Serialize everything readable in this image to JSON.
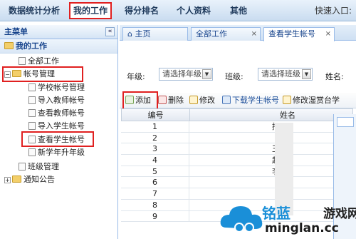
{
  "topnav": {
    "items": [
      "数据统计分析",
      "我的工作",
      "得分排名",
      "个人资料",
      "其他"
    ],
    "quick_entry": "快速入口:"
  },
  "sidebar": {
    "title": "主菜单",
    "collapse_glyph": "«",
    "section": "我的工作",
    "tree": {
      "all_work": "全部工作",
      "account_mgmt": "帐号管理",
      "children": [
        "学校帐号管理",
        "导入教师帐号",
        "查看教师帐号",
        "导入学生帐号",
        "查看学生帐号",
        "新学年升年级"
      ],
      "class_mgmt": "班级管理",
      "notice": "通知公告"
    }
  },
  "tabs": [
    "主页",
    "全部工作",
    "查看学生帐号"
  ],
  "filter": {
    "grade_label": "年级:",
    "grade_value": "请选择年级",
    "class_label": "班级:",
    "class_value": "请选择班级",
    "name_label": "姓名:"
  },
  "toolbar": {
    "add": "添加",
    "delete": "删除",
    "edit": "修改",
    "download": "下载学生帐号",
    "edit_partial": "修改湿赏台学"
  },
  "grid": {
    "columns": [
      "编号",
      "姓名"
    ],
    "rows": [
      {
        "id": "1",
        "name": "摺"
      },
      {
        "id": "2",
        "name": ""
      },
      {
        "id": "3",
        "name": "王"
      },
      {
        "id": "4",
        "name": "赵"
      },
      {
        "id": "5",
        "name": "李"
      },
      {
        "id": "6",
        "name": ""
      },
      {
        "id": "7",
        "name": ""
      },
      {
        "id": "8",
        "name": ""
      },
      {
        "id": "9",
        "name": ""
      }
    ]
  },
  "watermark": {
    "brand": "铭蓝",
    "suffix": "游戏网",
    "domain": "minglan.cc"
  },
  "colors": {
    "highlight_red": "#e02020",
    "nav_text": "#1f3a5c",
    "panel_border": "#99bbe8",
    "watermark_blue": "#1a8fd8"
  }
}
